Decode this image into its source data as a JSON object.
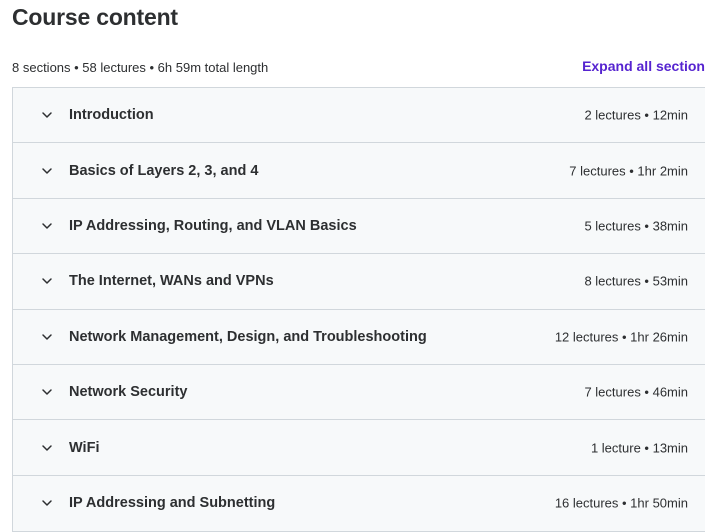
{
  "header": {
    "title": "Course content",
    "summary": "8 sections • 58 lectures • 6h 59m total length",
    "expand_all_label": "Expand all section"
  },
  "icons": {
    "section_toggle": "chevron-down-icon"
  },
  "colors": {
    "accent": "#5624d0",
    "section_bg": "#f7f9fa",
    "border": "#d1d7dc",
    "text": "#2d2f31"
  },
  "sections": [
    {
      "title": "Introduction",
      "meta": "2 lectures • 12min"
    },
    {
      "title": "Basics of Layers 2, 3, and 4",
      "meta": "7 lectures • 1hr 2min"
    },
    {
      "title": "IP Addressing, Routing, and VLAN Basics",
      "meta": "5 lectures • 38min"
    },
    {
      "title": "The Internet, WANs and VPNs",
      "meta": "8 lectures • 53min"
    },
    {
      "title": "Network Management, Design, and Troubleshooting",
      "meta": "12 lectures • 1hr 26min"
    },
    {
      "title": "Network Security",
      "meta": "7 lectures • 46min"
    },
    {
      "title": "WiFi",
      "meta": "1 lecture • 13min"
    },
    {
      "title": "IP Addressing and Subnetting",
      "meta": "16 lectures • 1hr 50min"
    }
  ]
}
